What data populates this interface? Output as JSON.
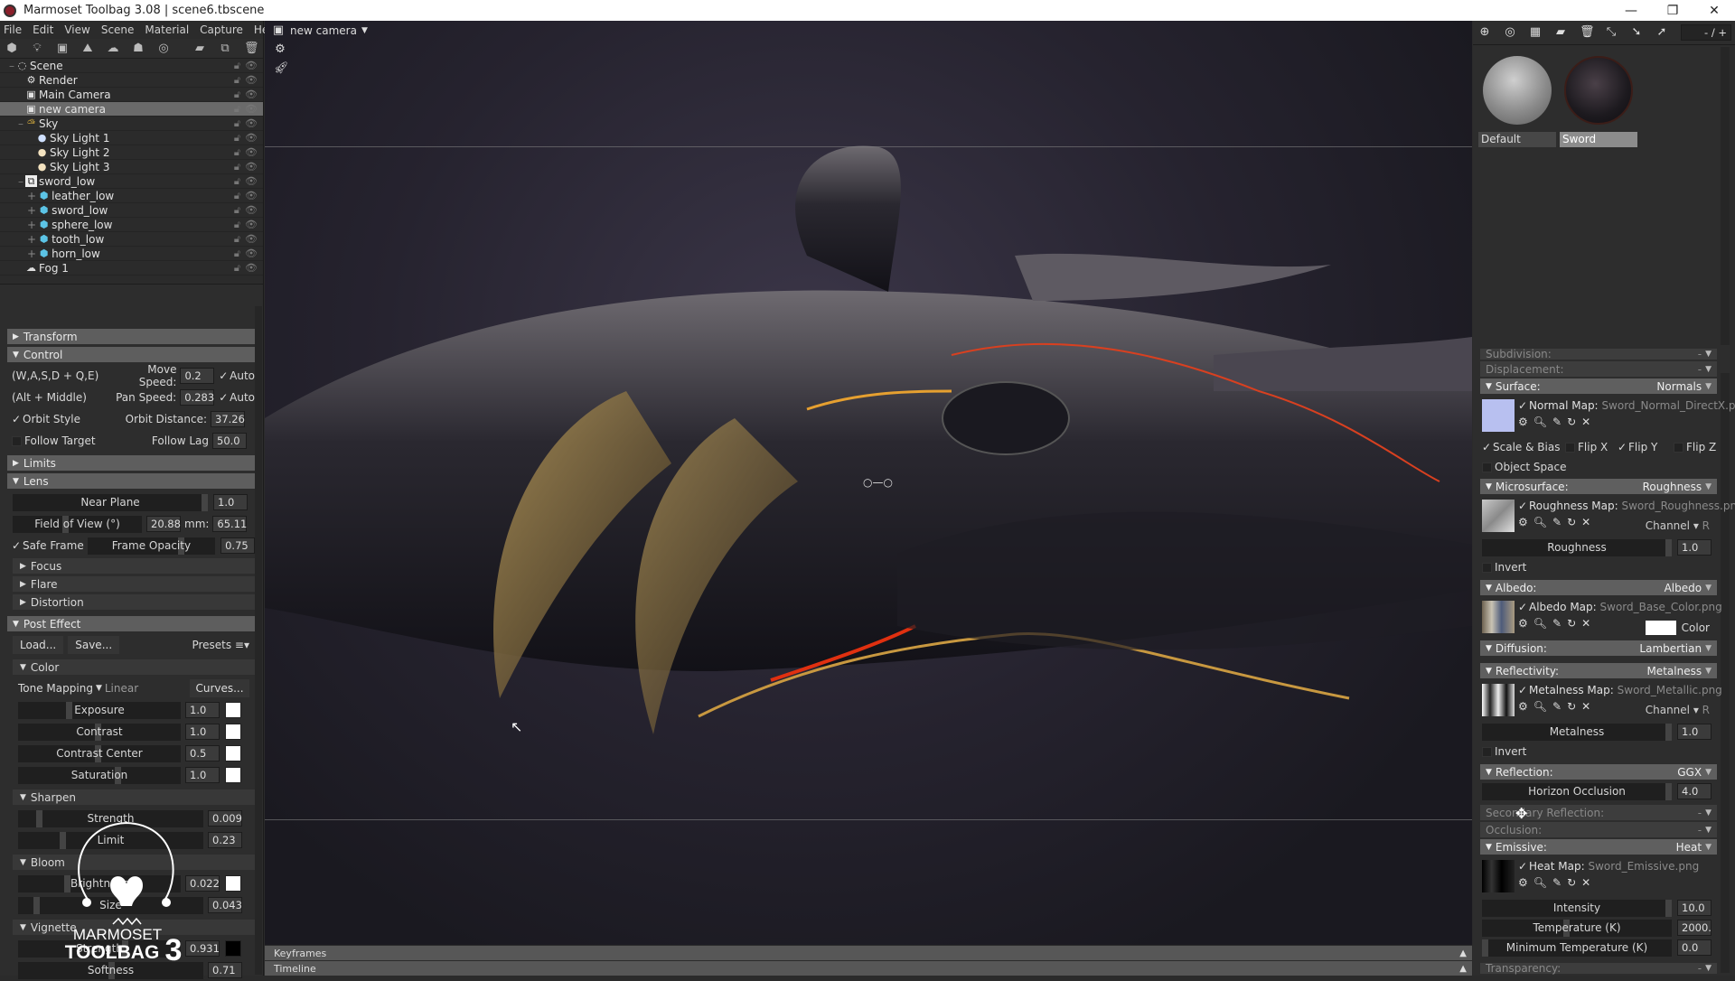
{
  "window": {
    "title": "Marmoset Toolbag 3.08  |  scene6.tbscene",
    "controls": [
      "minimize",
      "maximize",
      "close"
    ]
  },
  "menu": [
    "File",
    "Edit",
    "View",
    "Scene",
    "Material",
    "Capture",
    "Help"
  ],
  "scene_toolbar": [
    "mesh-icon",
    "light-icon",
    "camera-icon",
    "shadow-catcher-icon",
    "sky-icon",
    "fog-icon",
    "turntable-icon",
    "folder-icon",
    "duplicate-icon",
    "delete-icon"
  ],
  "scene_tree": [
    {
      "label": "Scene",
      "icon": "scene-icon",
      "depth": 0
    },
    {
      "label": "Render",
      "icon": "gear-icon",
      "depth": 1
    },
    {
      "label": "Main Camera",
      "icon": "camera-icon",
      "depth": 1
    },
    {
      "label": "new camera",
      "icon": "camera-icon",
      "depth": 1,
      "selected": true
    },
    {
      "label": "Sky",
      "icon": "sky-icon",
      "depth": 1
    },
    {
      "label": "Sky Light 1",
      "icon": "bulb-icon",
      "depth": 2
    },
    {
      "label": "Sky Light 2",
      "icon": "bulb-icon",
      "depth": 2
    },
    {
      "label": "Sky Light 3",
      "icon": "bulb-icon",
      "depth": 2
    },
    {
      "label": "sword_low",
      "icon": "group-icon",
      "depth": 1
    },
    {
      "label": "leather_low",
      "icon": "mesh-icon",
      "depth": 2
    },
    {
      "label": "sword_low",
      "icon": "mesh-icon",
      "depth": 2
    },
    {
      "label": "sphere_low",
      "icon": "mesh-icon",
      "depth": 2
    },
    {
      "label": "tooth_low",
      "icon": "mesh-icon",
      "depth": 2
    },
    {
      "label": "horn_low",
      "icon": "mesh-icon",
      "depth": 2
    },
    {
      "label": "Fog 1",
      "icon": "fog-icon",
      "depth": 1
    }
  ],
  "camera_props": {
    "transform": "Transform",
    "control": {
      "title": "Control",
      "wasd": "(W,A,S,D + Q,E)",
      "move_speed_label": "Move Speed:",
      "move_speed": "0.2",
      "auto1": "Auto",
      "alt_middle": "(Alt + Middle)",
      "pan_speed_label": "Pan Speed:",
      "pan_speed": "0.283",
      "auto2": "Auto",
      "orbit_style": "Orbit Style",
      "orbit_distance_label": "Orbit Distance:",
      "orbit_distance": "37.26",
      "follow_target": "Follow Target",
      "follow_lag_label": "Follow Lag",
      "follow_lag": "50.0"
    },
    "limits": "Limits",
    "lens": {
      "title": "Lens",
      "near_plane_label": "Near Plane",
      "near_plane": "1.0",
      "fov_label": "Field of View (°)",
      "fov": "20.88",
      "mm_label": "mm:",
      "mm": "65.11",
      "safe_frame": "Safe Frame",
      "frame_opacity_label": "Frame Opacity",
      "frame_opacity": "0.75",
      "focus": "Focus",
      "flare": "Flare",
      "distortion": "Distortion"
    },
    "post_effect": {
      "title": "Post Effect",
      "load": "Load...",
      "save": "Save...",
      "presets": "Presets ≡▾",
      "color": "Color",
      "tone_mapping_label": "Tone Mapping",
      "tone_mapping_value": "Linear",
      "curves": "Curves...",
      "exposure_label": "Exposure",
      "exposure": "1.0",
      "contrast_label": "Contrast",
      "contrast": "1.0",
      "contrast_center_label": "Contrast Center",
      "contrast_center": "0.5",
      "saturation_label": "Saturation",
      "saturation": "1.0",
      "sharpen": "Sharpen",
      "sharpen_strength_label": "Strength",
      "sharpen_strength": "0.009",
      "limit_label": "Limit",
      "limit": "0.23",
      "bloom": "Bloom",
      "brightness_label": "Brightness",
      "brightness": "0.022",
      "size_label": "Size",
      "size": "0.043",
      "vignette": "Vignette",
      "vignette_strength_label": "Strength",
      "vignette_strength": "0.931",
      "softness_label": "Softness",
      "softness": "0.71"
    }
  },
  "viewport": {
    "camera_selector": "new camera",
    "keyframes": "Keyframes",
    "timeline": "Timeline"
  },
  "watermark": {
    "line1": "MARMOSET",
    "line2": "TOOLBAG",
    "version": "3"
  },
  "materials": {
    "counter": "- / +",
    "items": [
      {
        "name": "Default",
        "selected": false
      },
      {
        "name": "Sword",
        "selected": true
      }
    ]
  },
  "material_props": {
    "subdivision": {
      "label": "Subdivision:",
      "value": "-"
    },
    "displacement": {
      "label": "Displacement:",
      "value": "-"
    },
    "surface": {
      "label": "Surface:",
      "value": "Normals",
      "map_label": "Normal Map:",
      "map_file": "Sword_Normal_DirectX.png",
      "scale_bias": "Scale & Bias",
      "flip_x": "Flip X",
      "flip_y": "Flip Y",
      "flip_z": "Flip Z",
      "object_space": "Object Space",
      "swatch_color": "#b8c0f0"
    },
    "microsurface": {
      "label": "Microsurface:",
      "value": "Roughness",
      "map_label": "Roughness Map:",
      "map_file": "Sword_Roughness.png",
      "channel_label": "Channel",
      "channel": "R",
      "slider_label": "Roughness",
      "slider_value": "1.0",
      "invert": "Invert"
    },
    "albedo": {
      "label": "Albedo:",
      "value": "Albedo",
      "map_label": "Albedo Map:",
      "map_file": "Sword_Base_Color.png",
      "color_label": "Color"
    },
    "diffusion": {
      "label": "Diffusion:",
      "value": "Lambertian"
    },
    "reflectivity": {
      "label": "Reflectivity:",
      "value": "Metalness",
      "map_label": "Metalness Map:",
      "map_file": "Sword_Metallic.png",
      "channel_label": "Channel",
      "channel": "R",
      "slider_label": "Metalness",
      "slider_value": "1.0",
      "invert": "Invert"
    },
    "reflection": {
      "label": "Reflection:",
      "value": "GGX",
      "horizon_label": "Horizon Occlusion",
      "horizon_value": "4.0"
    },
    "secondary_reflection": {
      "label": "Secondary Reflection:",
      "value": "-"
    },
    "occlusion": {
      "label": "Occlusion:",
      "value": "-"
    },
    "emissive": {
      "label": "Emissive:",
      "value": "Heat",
      "map_label": "Heat Map:",
      "map_file": "Sword_Emissive.png",
      "intensity_label": "Intensity",
      "intensity": "10.0",
      "temperature_label": "Temperature (K)",
      "temperature": "2000.",
      "min_temp_label": "Minimum Temperature (K)",
      "min_temp": "0.0"
    },
    "transparency": {
      "label": "Transparency:",
      "value": "-"
    }
  }
}
